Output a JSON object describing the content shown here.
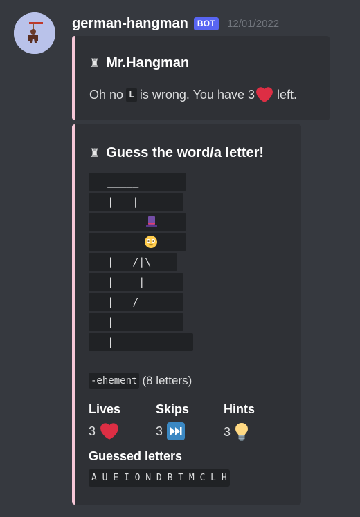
{
  "message": {
    "username": "german-hangman",
    "badge": "BOT",
    "timestamp": "12/01/2022"
  },
  "embed1": {
    "title_icon": "chess-pawn-icon",
    "title": "Mr.Hangman",
    "desc_before": "Oh no",
    "letter": "L",
    "desc_middle": "is wrong. You have 3",
    "desc_after": "left.",
    "heart_icon": "heart-icon"
  },
  "embed2": {
    "title_icon": "chess-pawn-icon",
    "title": "Guess the word/a letter!",
    "gallows": [
      "   _____ ",
      "   |   |",
      "   |   ",
      "   |   ",
      "   |   /|\\",
      "   |    |",
      "   |   /",
      "   |",
      "   |_________"
    ],
    "hat_icon": "top-hat-icon",
    "face_icon": "flushed-face-icon",
    "word_code": "-ehement",
    "word_info": "(8 letters)",
    "fields": {
      "lives": {
        "name": "Lives",
        "value": "3",
        "icon": "heart-icon"
      },
      "skips": {
        "name": "Skips",
        "value": "3",
        "icon": "next-track-icon"
      },
      "hints": {
        "name": "Hints",
        "value": "3",
        "icon": "light-bulb-icon"
      }
    },
    "guessed_title": "Guessed letters",
    "guessed_letters": "A U E I O N D B T M C L H"
  },
  "colors": {
    "background": "#36393f",
    "embed_bg": "#2f3136",
    "embed_accent": "#f6c7d7",
    "badge": "#5865f2",
    "code_bg": "#202225",
    "heart": "#dd2e44",
    "skip_blue": "#3b88c3",
    "bulb": "#ffd983"
  }
}
